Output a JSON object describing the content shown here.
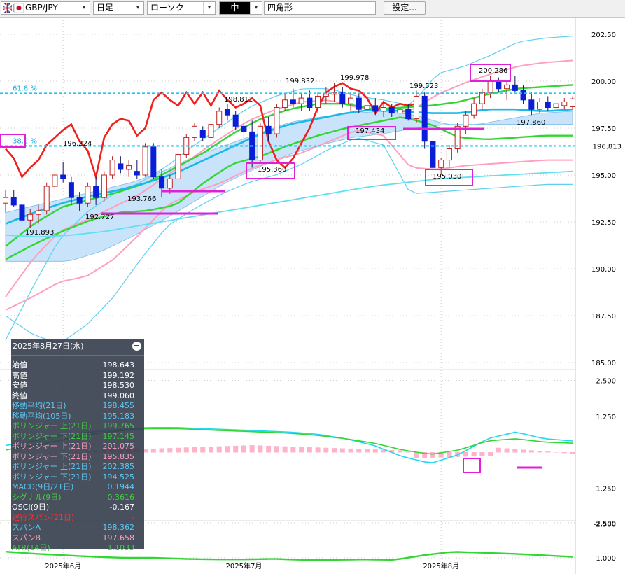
{
  "toolbar": {
    "pair": "GBP/JPY",
    "timeframe": "日足",
    "chart_type": "ローソク",
    "line_width": "中",
    "drawing_tool": "四角形",
    "settings_label": "設定..."
  },
  "info_panel": {
    "date": "2025年8月27日(水)",
    "rows": [
      {
        "label": "始値",
        "value": "198.643",
        "color": "#ffffff"
      },
      {
        "label": "高値",
        "value": "199.192",
        "color": "#ffffff"
      },
      {
        "label": "安値",
        "value": "198.530",
        "color": "#ffffff"
      },
      {
        "label": "終値",
        "value": "199.060",
        "color": "#ffffff"
      },
      {
        "label": "移動平均(21日)",
        "value": "198.455",
        "color": "#5bc8f5"
      },
      {
        "label": "移動平均(105日)",
        "value": "195.183",
        "color": "#5bc8f5"
      },
      {
        "label": "ボリンジャー 上(21日)",
        "value": "199.765",
        "color": "#3cd23c"
      },
      {
        "label": "ボリンジャー 下(21日)",
        "value": "197.145",
        "color": "#3cd23c"
      },
      {
        "label": "ボリンジャー 上(21日)",
        "value": "201.075",
        "color": "#ff9fc0"
      },
      {
        "label": "ボリンジャー 下(21日)",
        "value": "195.835",
        "color": "#ff9fc0"
      },
      {
        "label": "ボリンジャー 上(21日)",
        "value": "202.385",
        "color": "#5bc8f5"
      },
      {
        "label": "ボリンジャー 下(21日)",
        "value": "194.525",
        "color": "#5bc8f5"
      },
      {
        "label": "MACD(9日/21日)",
        "value": "0.1944",
        "color": "#5bc8f5"
      },
      {
        "label": "シグナル(9日)",
        "value": "0.3616",
        "color": "#3cd23c"
      },
      {
        "label": "OSCI(9日)",
        "value": "-0.167",
        "color": "#ffffff"
      },
      {
        "label": "遅行スパン(21日)",
        "value": "-",
        "color": "#ff3030"
      },
      {
        "label": "スパンA",
        "value": "198.362",
        "color": "#5bc8f5"
      },
      {
        "label": "スパンB",
        "value": "197.658",
        "color": "#ff9fc0"
      },
      {
        "label": "ATR(14日)",
        "value": "1.1033",
        "color": "#3cd23c"
      }
    ]
  },
  "chart_data": [
    {
      "type": "candlestick",
      "y_ticks": [
        "202.50",
        "200.00",
        "197.50",
        "195.00",
        "192.50",
        "190.00",
        "187.50",
        "185.00"
      ],
      "ylim": [
        183.4,
        203.4
      ],
      "x_labels": [
        {
          "label": "2025年6月",
          "index": 7
        },
        {
          "label": "2025年7月",
          "index": 29
        },
        {
          "label": "2025年8月",
          "index": 53
        }
      ],
      "candles_ohlc": [
        [
          193.5,
          194.2,
          193.0,
          193.8
        ],
        [
          193.8,
          194.2,
          193.3,
          193.4
        ],
        [
          193.4,
          193.9,
          192.5,
          192.6
        ],
        [
          192.6,
          193.2,
          192.2,
          192.9
        ],
        [
          192.9,
          193.4,
          192.4,
          193.1
        ],
        [
          193.1,
          194.6,
          192.9,
          194.4
        ],
        [
          194.4,
          195.2,
          194.0,
          195.0
        ],
        [
          195.0,
          195.7,
          194.6,
          194.8
        ],
        [
          194.6,
          194.9,
          193.4,
          193.8
        ],
        [
          193.8,
          194.1,
          193.1,
          193.5
        ],
        [
          193.5,
          194.6,
          193.3,
          194.4
        ],
        [
          194.4,
          194.9,
          193.4,
          193.8
        ],
        [
          193.8,
          195.2,
          193.6,
          195.0
        ],
        [
          195.0,
          196.0,
          194.8,
          195.8
        ],
        [
          195.6,
          196.0,
          195.1,
          195.3
        ],
        [
          195.3,
          195.8,
          194.9,
          195.5
        ],
        [
          195.2,
          195.8,
          194.8,
          195.0
        ],
        [
          195.0,
          196.7,
          194.9,
          196.5
        ],
        [
          196.5,
          196.7,
          194.8,
          194.9
        ],
        [
          194.9,
          195.3,
          193.8,
          194.3
        ],
        [
          194.3,
          195.0,
          194.0,
          194.8
        ],
        [
          194.8,
          196.3,
          194.6,
          196.1
        ],
        [
          196.1,
          197.2,
          195.9,
          197.0
        ],
        [
          197.0,
          197.8,
          196.8,
          197.6
        ],
        [
          197.4,
          197.6,
          196.8,
          197.0
        ],
        [
          197.0,
          197.9,
          196.8,
          197.7
        ],
        [
          197.7,
          198.6,
          197.5,
          198.4
        ],
        [
          198.5,
          198.8,
          197.9,
          198.2
        ],
        [
          198.2,
          198.4,
          197.4,
          197.6
        ],
        [
          197.6,
          198.0,
          196.4,
          197.3
        ],
        [
          197.3,
          197.9,
          195.4,
          195.8
        ],
        [
          195.8,
          197.8,
          195.6,
          197.6
        ],
        [
          197.6,
          198.1,
          196.8,
          197.2
        ],
        [
          197.2,
          198.8,
          197.0,
          198.6
        ],
        [
          198.6,
          199.3,
          198.4,
          199.0
        ],
        [
          199.0,
          199.6,
          198.6,
          198.8
        ],
        [
          198.8,
          199.3,
          198.4,
          199.1
        ],
        [
          199.1,
          199.5,
          198.4,
          198.6
        ],
        [
          198.6,
          199.4,
          198.3,
          199.2
        ],
        [
          199.2,
          199.7,
          198.8,
          199.3
        ],
        [
          199.3,
          199.9,
          198.9,
          199.4
        ],
        [
          199.4,
          199.7,
          198.6,
          198.8
        ],
        [
          198.8,
          199.4,
          198.4,
          199.1
        ],
        [
          199.1,
          199.3,
          198.3,
          198.5
        ],
        [
          198.5,
          199.0,
          198.2,
          198.7
        ],
        [
          198.7,
          199.1,
          198.2,
          198.4
        ],
        [
          198.4,
          198.9,
          198.1,
          198.6
        ],
        [
          198.6,
          198.8,
          198.1,
          198.3
        ],
        [
          198.3,
          198.7,
          197.9,
          198.5
        ],
        [
          198.5,
          198.8,
          197.9,
          198.0
        ],
        [
          198.0,
          199.5,
          197.8,
          199.2
        ],
        [
          199.2,
          199.4,
          196.4,
          196.8
        ],
        [
          196.8,
          196.9,
          195.2,
          195.4
        ],
        [
          195.4,
          195.9,
          195.0,
          195.8
        ],
        [
          195.8,
          196.6,
          195.4,
          196.4
        ],
        [
          196.4,
          197.8,
          196.2,
          197.6
        ],
        [
          197.6,
          198.4,
          197.2,
          198.2
        ],
        [
          198.2,
          199.1,
          198.0,
          198.8
        ],
        [
          198.8,
          199.6,
          198.5,
          199.4
        ],
        [
          199.4,
          200.3,
          199.1,
          200.0
        ],
        [
          200.0,
          200.2,
          199.4,
          199.6
        ],
        [
          199.6,
          200.0,
          199.0,
          199.8
        ],
        [
          199.8,
          200.3,
          199.4,
          199.5
        ],
        [
          199.5,
          199.8,
          198.8,
          199.0
        ],
        [
          199.0,
          199.4,
          198.2,
          198.5
        ],
        [
          198.5,
          199.1,
          198.3,
          198.9
        ],
        [
          198.9,
          199.2,
          198.4,
          198.6
        ],
        [
          198.6,
          198.9,
          198.4,
          198.8
        ],
        [
          198.7,
          199.1,
          198.5,
          198.9
        ],
        [
          198.64,
          199.19,
          198.53,
          199.06
        ]
      ],
      "annotations": [
        "191.893",
        "192.727",
        "193.766",
        "195.360",
        "196.224",
        "198.811",
        "199.832",
        "199.978",
        "197.434",
        "199.523",
        "195.030",
        "200.286",
        "197.860"
      ],
      "fib_labels": [
        "61.8 %",
        "38.2 %"
      ],
      "fib_values": [
        199.35,
        196.55
      ],
      "right_label_current": "196.813"
    },
    {
      "type": "histogram+line",
      "name": "MACD",
      "y_ticks": [
        "2.500",
        "1.250",
        "-1.250",
        "-2.500"
      ],
      "ylim": [
        -3.0,
        3.0
      ]
    },
    {
      "type": "line",
      "name": "ATR",
      "y_ticks": [
        "2.500",
        "1.000"
      ],
      "ylim": [
        0.85,
        2.65
      ]
    }
  ]
}
